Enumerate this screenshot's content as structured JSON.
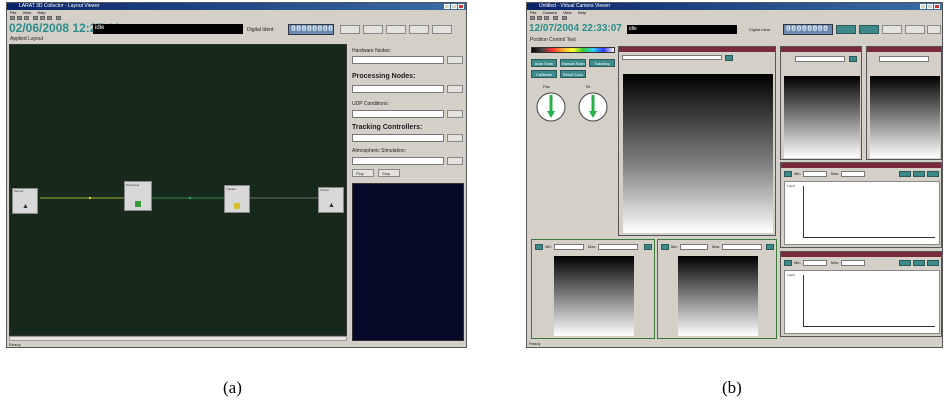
{
  "window_a": {
    "title": "LARAT 3D Collector - Layout Viewer",
    "menu": [
      "File",
      "View",
      "Help"
    ],
    "datetime": "02/06/2008 12:27:16",
    "status": "idle",
    "digital_label": "Digital Ident",
    "digital_value": "00000000",
    "sub_label": "Applied Layout",
    "panel_headings": [
      "Hardware Nodes:",
      "Processing Nodes:",
      "UDP Conditions:",
      "Tracking Controllers:",
      "Atmospheric Simulation:"
    ],
    "small_buttons": [
      "Play",
      "Stop"
    ],
    "nodes": [
      "Sensor",
      "Processor",
      "Tracker",
      "Output"
    ],
    "statusbar": "Ready"
  },
  "window_b": {
    "title": "Untitled - Virtual Camera Viewer",
    "menu": [
      "File",
      "Camera",
      "View",
      "Help"
    ],
    "datetime": "12/07/2004 22:33:07",
    "status": "idle",
    "digital_label": "Digital Ident",
    "digital_value": "00000000",
    "sub_label": "Position Control Test",
    "control_buttons": [
      "Auto Scan",
      "Manual Scan",
      "Tracking",
      "Calibrate",
      "Reset Cam"
    ],
    "gauge_labels": [
      "Pan",
      "Tilt"
    ],
    "panel_labels": [
      "Min",
      "Max"
    ],
    "plot_tick": "1.0e0",
    "statusbar": "Ready"
  },
  "captions": {
    "a": "(a)",
    "b": "(b)"
  }
}
